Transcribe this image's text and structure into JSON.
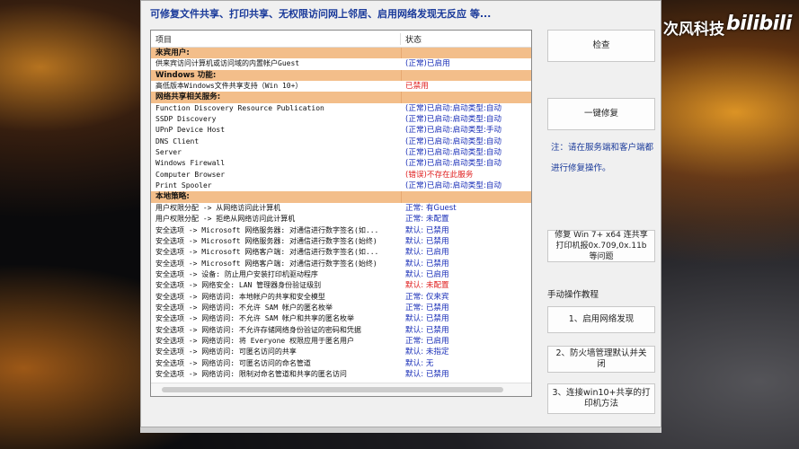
{
  "watermark": {
    "text": "次风科技",
    "logo": "bilibili"
  },
  "window": {
    "title": "可修复文件共享、打印共享、无权限访问网上邻居、启用网络发现无反应  等...",
    "table": {
      "headers": [
        "项目",
        "状态"
      ],
      "rows": [
        {
          "item": "来宾用户:",
          "status": "",
          "type": "cat"
        },
        {
          "item": "供来宾访问计算机或访问域的内置帐户Guest",
          "status": "(正常)已启用",
          "type": "ok"
        },
        {
          "item": "Windows 功能:",
          "status": "",
          "type": "cat"
        },
        {
          "item": "高低版本Windows文件共享支持（Win 10+）",
          "status": "已禁用",
          "type": "bad"
        },
        {
          "item": "网络共享相关服务:",
          "status": "",
          "type": "cat"
        },
        {
          "item": "Function Discovery Resource Publication",
          "status": "(正常)已启动:启动类型:自动",
          "type": "ok"
        },
        {
          "item": "SSDP Discovery",
          "status": "(正常)已启动:启动类型:自动",
          "type": "ok"
        },
        {
          "item": "UPnP Device Host",
          "status": "(正常)已启动:启动类型:手动",
          "type": "ok"
        },
        {
          "item": "DNS Client",
          "status": "(正常)已启动:启动类型:自动",
          "type": "ok"
        },
        {
          "item": "Server",
          "status": "(正常)已启动:启动类型:自动",
          "type": "ok"
        },
        {
          "item": "Windows Firewall",
          "status": "(正常)已启动:启动类型:自动",
          "type": "ok"
        },
        {
          "item": "Computer Browser",
          "status": "(错误)不存在此服务",
          "type": "bad"
        },
        {
          "item": "Print Spooler",
          "status": "(正常)已启动:启动类型:自动",
          "type": "ok"
        },
        {
          "item": "本地策略:",
          "status": "",
          "type": "cat"
        },
        {
          "item": "用户权限分配 -> 从网络访问此计算机",
          "status": "正常: 有Guest",
          "type": "ok"
        },
        {
          "item": "用户权限分配 -> 拒绝从网络访问此计算机",
          "status": "正常: 未配置",
          "type": "ok"
        },
        {
          "item": "安全选项 -> Microsoft 网络服务器: 对通信进行数字签名(如...",
          "status": "默认: 已禁用",
          "type": "ok"
        },
        {
          "item": "安全选项 -> Microsoft 网络服务器: 对通信进行数字签名(始终)",
          "status": "默认: 已禁用",
          "type": "ok"
        },
        {
          "item": "安全选项 -> Microsoft 网络客户端: 对通信进行数字签名(如...",
          "status": "默认: 已启用",
          "type": "ok"
        },
        {
          "item": "安全选项 -> Microsoft 网络客户端: 对通信进行数字签名(始终)",
          "status": "默认: 已禁用",
          "type": "ok"
        },
        {
          "item": "安全选项 -> 设备: 防止用户安装打印机驱动程序",
          "status": "默认: 已启用",
          "type": "ok"
        },
        {
          "item": "安全选项 -> 网络安全: LAN 管理器身份验证级别",
          "status": "默认: 未配置",
          "type": "bad"
        },
        {
          "item": "安全选项 -> 网络访问: 本地帐户的共享和安全模型",
          "status": "正常: 仅来宾",
          "type": "ok"
        },
        {
          "item": "安全选项 -> 网络访问: 不允许 SAM 帐户的匿名枚举",
          "status": "正常: 已禁用",
          "type": "ok"
        },
        {
          "item": "安全选项 -> 网络访问: 不允许 SAM 帐户和共享的匿名枚举",
          "status": "默认: 已禁用",
          "type": "ok"
        },
        {
          "item": "安全选项 -> 网络访问: 不允许存储网络身份验证的密码和凭据",
          "status": "默认: 已禁用",
          "type": "ok"
        },
        {
          "item": "安全选项 -> 网络访问: 将 Everyone 权限应用于匿名用户",
          "status": "正常: 已启用",
          "type": "ok"
        },
        {
          "item": "安全选项 -> 网络访问: 可匿名访问的共享",
          "status": "默认: 未指定",
          "type": "ok"
        },
        {
          "item": "安全选项 -> 网络访问: 可匿名访问的命名管道",
          "status": "默认: 无",
          "type": "ok"
        },
        {
          "item": "安全选项 -> 网络访问: 限制对命名管道和共享的匿名访问",
          "status": "默认: 已禁用",
          "type": "ok"
        }
      ]
    },
    "buttons": {
      "check": "检查",
      "repair": "一键修复",
      "win7_fix": "修复 Win 7+ x64 连共享打印机报0x.709,0x.11b等问题",
      "enable_discovery": "1、启用网络发现",
      "firewall": "2、防火墙管理默认并关闭",
      "win10_printer": "3、连接win10+共享的打印机方法"
    },
    "note": "注：请在服务端和客户端都进行修复操作。",
    "tutorial_label": "手动操作教程"
  }
}
